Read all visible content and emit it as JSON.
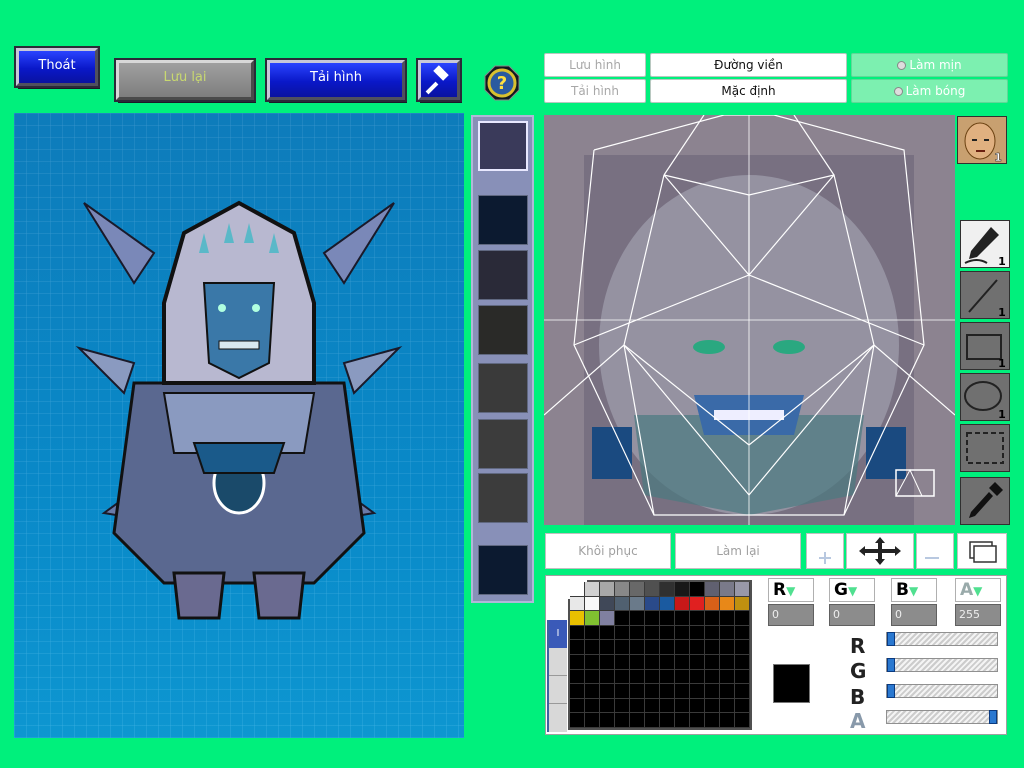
{
  "top_buttons": {
    "exit": "Thoát",
    "save": "Lưu lại",
    "reload": "Tải hình"
  },
  "tabs": {
    "save_image": "Lưu hình",
    "outline": "Đường viền",
    "smooth": "Làm mịn",
    "load_image": "Tải hình",
    "default": "Mặc định",
    "shadow": "Làm bóng"
  },
  "bottom_buttons": {
    "restore": "Khôi phục",
    "redo": "Làm lại"
  },
  "tool_counts": {
    "brush": "1",
    "line": "1",
    "rect": "1",
    "ellipse": "1",
    "avatar": "1"
  },
  "channels": {
    "r": {
      "label": "R",
      "value": "0"
    },
    "g": {
      "label": "G",
      "value": "0"
    },
    "b": {
      "label": "B",
      "value": "0"
    },
    "a": {
      "label": "A",
      "value": "255"
    }
  },
  "sliders": {
    "r": 0.0,
    "g": 0.0,
    "b": 0.0,
    "a": 1.0
  },
  "current_color": "#000000",
  "palette_colors": [
    "#ffffff",
    "#d0d0d0",
    "#a8a8a8",
    "#888888",
    "#686868",
    "#505050",
    "#303030",
    "#181818",
    "#000000",
    "#606070",
    "#7a7a8a",
    "#9898a8",
    "#e8e8e8",
    "#f8f8f8",
    "#404858",
    "#506070",
    "#6a7a8a",
    "#2a4a8a",
    "#1a5aa0",
    "#c81818",
    "#e02020",
    "#d86018",
    "#e88818",
    "#c09010",
    "#e8c000",
    "#80c030",
    "#8080a0"
  ],
  "icons": {
    "hammer": "hammer-icon",
    "help": "help-icon",
    "avatar": "avatar-icon",
    "brush": "brush-icon",
    "line": "line-icon",
    "rect": "rectangle-icon",
    "ellipse": "ellipse-icon",
    "select": "selection-icon",
    "eyedropper": "eyedropper-icon",
    "move": "move-icon",
    "zoom_in": "zoom-in-icon",
    "zoom_out": "zoom-out-icon",
    "layers": "layers-icon"
  }
}
